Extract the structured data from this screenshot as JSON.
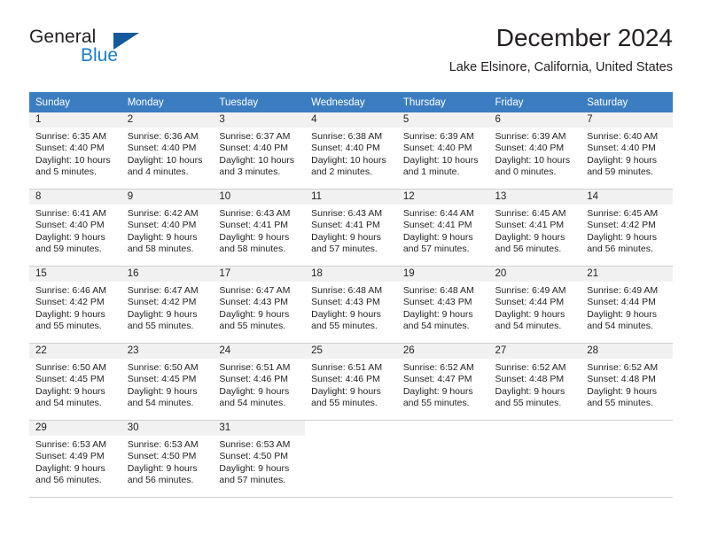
{
  "brand": {
    "name_top": "General",
    "name_bottom": "Blue",
    "accent_color": "#1f7dc4",
    "triangle_color": "#13599c"
  },
  "header": {
    "month_title": "December 2024",
    "location": "Lake Elsinore, California, United States",
    "header_bg": "#3b7dc0",
    "date_strip_bg": "#f1f1f1"
  },
  "weekdays": [
    "Sunday",
    "Monday",
    "Tuesday",
    "Wednesday",
    "Thursday",
    "Friday",
    "Saturday"
  ],
  "weeks": [
    [
      {
        "date": "1",
        "sunrise": "Sunrise: 6:35 AM",
        "sunset": "Sunset: 4:40 PM",
        "daylight": "Daylight: 10 hours and 5 minutes."
      },
      {
        "date": "2",
        "sunrise": "Sunrise: 6:36 AM",
        "sunset": "Sunset: 4:40 PM",
        "daylight": "Daylight: 10 hours and 4 minutes."
      },
      {
        "date": "3",
        "sunrise": "Sunrise: 6:37 AM",
        "sunset": "Sunset: 4:40 PM",
        "daylight": "Daylight: 10 hours and 3 minutes."
      },
      {
        "date": "4",
        "sunrise": "Sunrise: 6:38 AM",
        "sunset": "Sunset: 4:40 PM",
        "daylight": "Daylight: 10 hours and 2 minutes."
      },
      {
        "date": "5",
        "sunrise": "Sunrise: 6:39 AM",
        "sunset": "Sunset: 4:40 PM",
        "daylight": "Daylight: 10 hours and 1 minute."
      },
      {
        "date": "6",
        "sunrise": "Sunrise: 6:39 AM",
        "sunset": "Sunset: 4:40 PM",
        "daylight": "Daylight: 10 hours and 0 minutes."
      },
      {
        "date": "7",
        "sunrise": "Sunrise: 6:40 AM",
        "sunset": "Sunset: 4:40 PM",
        "daylight": "Daylight: 9 hours and 59 minutes."
      }
    ],
    [
      {
        "date": "8",
        "sunrise": "Sunrise: 6:41 AM",
        "sunset": "Sunset: 4:40 PM",
        "daylight": "Daylight: 9 hours and 59 minutes."
      },
      {
        "date": "9",
        "sunrise": "Sunrise: 6:42 AM",
        "sunset": "Sunset: 4:40 PM",
        "daylight": "Daylight: 9 hours and 58 minutes."
      },
      {
        "date": "10",
        "sunrise": "Sunrise: 6:43 AM",
        "sunset": "Sunset: 4:41 PM",
        "daylight": "Daylight: 9 hours and 58 minutes."
      },
      {
        "date": "11",
        "sunrise": "Sunrise: 6:43 AM",
        "sunset": "Sunset: 4:41 PM",
        "daylight": "Daylight: 9 hours and 57 minutes."
      },
      {
        "date": "12",
        "sunrise": "Sunrise: 6:44 AM",
        "sunset": "Sunset: 4:41 PM",
        "daylight": "Daylight: 9 hours and 57 minutes."
      },
      {
        "date": "13",
        "sunrise": "Sunrise: 6:45 AM",
        "sunset": "Sunset: 4:41 PM",
        "daylight": "Daylight: 9 hours and 56 minutes."
      },
      {
        "date": "14",
        "sunrise": "Sunrise: 6:45 AM",
        "sunset": "Sunset: 4:42 PM",
        "daylight": "Daylight: 9 hours and 56 minutes."
      }
    ],
    [
      {
        "date": "15",
        "sunrise": "Sunrise: 6:46 AM",
        "sunset": "Sunset: 4:42 PM",
        "daylight": "Daylight: 9 hours and 55 minutes."
      },
      {
        "date": "16",
        "sunrise": "Sunrise: 6:47 AM",
        "sunset": "Sunset: 4:42 PM",
        "daylight": "Daylight: 9 hours and 55 minutes."
      },
      {
        "date": "17",
        "sunrise": "Sunrise: 6:47 AM",
        "sunset": "Sunset: 4:43 PM",
        "daylight": "Daylight: 9 hours and 55 minutes."
      },
      {
        "date": "18",
        "sunrise": "Sunrise: 6:48 AM",
        "sunset": "Sunset: 4:43 PM",
        "daylight": "Daylight: 9 hours and 55 minutes."
      },
      {
        "date": "19",
        "sunrise": "Sunrise: 6:48 AM",
        "sunset": "Sunset: 4:43 PM",
        "daylight": "Daylight: 9 hours and 54 minutes."
      },
      {
        "date": "20",
        "sunrise": "Sunrise: 6:49 AM",
        "sunset": "Sunset: 4:44 PM",
        "daylight": "Daylight: 9 hours and 54 minutes."
      },
      {
        "date": "21",
        "sunrise": "Sunrise: 6:49 AM",
        "sunset": "Sunset: 4:44 PM",
        "daylight": "Daylight: 9 hours and 54 minutes."
      }
    ],
    [
      {
        "date": "22",
        "sunrise": "Sunrise: 6:50 AM",
        "sunset": "Sunset: 4:45 PM",
        "daylight": "Daylight: 9 hours and 54 minutes."
      },
      {
        "date": "23",
        "sunrise": "Sunrise: 6:50 AM",
        "sunset": "Sunset: 4:45 PM",
        "daylight": "Daylight: 9 hours and 54 minutes."
      },
      {
        "date": "24",
        "sunrise": "Sunrise: 6:51 AM",
        "sunset": "Sunset: 4:46 PM",
        "daylight": "Daylight: 9 hours and 54 minutes."
      },
      {
        "date": "25",
        "sunrise": "Sunrise: 6:51 AM",
        "sunset": "Sunset: 4:46 PM",
        "daylight": "Daylight: 9 hours and 55 minutes."
      },
      {
        "date": "26",
        "sunrise": "Sunrise: 6:52 AM",
        "sunset": "Sunset: 4:47 PM",
        "daylight": "Daylight: 9 hours and 55 minutes."
      },
      {
        "date": "27",
        "sunrise": "Sunrise: 6:52 AM",
        "sunset": "Sunset: 4:48 PM",
        "daylight": "Daylight: 9 hours and 55 minutes."
      },
      {
        "date": "28",
        "sunrise": "Sunrise: 6:52 AM",
        "sunset": "Sunset: 4:48 PM",
        "daylight": "Daylight: 9 hours and 55 minutes."
      }
    ],
    [
      {
        "date": "29",
        "sunrise": "Sunrise: 6:53 AM",
        "sunset": "Sunset: 4:49 PM",
        "daylight": "Daylight: 9 hours and 56 minutes."
      },
      {
        "date": "30",
        "sunrise": "Sunrise: 6:53 AM",
        "sunset": "Sunset: 4:50 PM",
        "daylight": "Daylight: 9 hours and 56 minutes."
      },
      {
        "date": "31",
        "sunrise": "Sunrise: 6:53 AM",
        "sunset": "Sunset: 4:50 PM",
        "daylight": "Daylight: 9 hours and 57 minutes."
      },
      {
        "date": "",
        "sunrise": "",
        "sunset": "",
        "daylight": ""
      },
      {
        "date": "",
        "sunrise": "",
        "sunset": "",
        "daylight": ""
      },
      {
        "date": "",
        "sunrise": "",
        "sunset": "",
        "daylight": ""
      },
      {
        "date": "",
        "sunrise": "",
        "sunset": "",
        "daylight": ""
      }
    ]
  ]
}
